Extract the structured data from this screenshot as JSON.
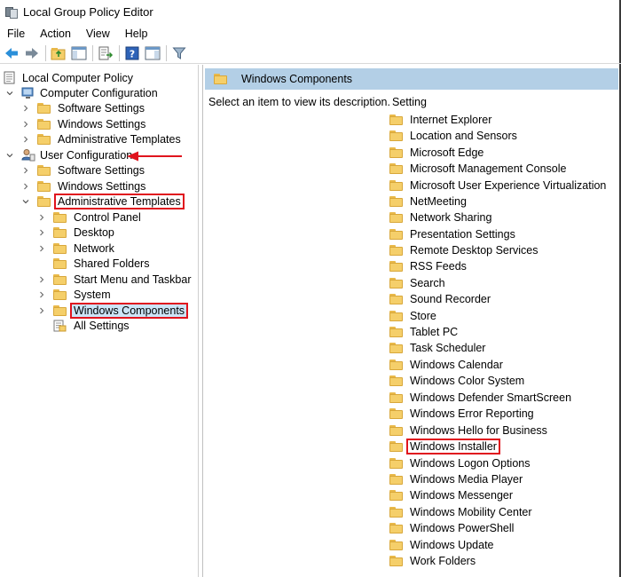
{
  "window": {
    "title": "Local Group Policy Editor"
  },
  "menu": [
    "File",
    "Action",
    "View",
    "Help"
  ],
  "tree": {
    "root": "Local Computer Policy",
    "computer_config": "Computer Configuration",
    "computer_children": [
      "Software Settings",
      "Windows Settings",
      "Administrative Templates"
    ],
    "user_config": "User Configuration",
    "user_children": [
      "Software Settings",
      "Windows Settings",
      "Administrative Templates"
    ],
    "admin_children": [
      "Control Panel",
      "Desktop",
      "Network",
      "Shared Folders",
      "Start Menu and Taskbar",
      "System",
      "Windows Components",
      "All Settings"
    ]
  },
  "right": {
    "header": "Windows Components",
    "description": "Select an item to view its description.",
    "column": "Setting",
    "settings": [
      "Internet Explorer",
      "Location and Sensors",
      "Microsoft Edge",
      "Microsoft Management Console",
      "Microsoft User Experience Virtualization",
      "NetMeeting",
      "Network Sharing",
      "Presentation Settings",
      "Remote Desktop Services",
      "RSS Feeds",
      "Search",
      "Sound Recorder",
      "Store",
      "Tablet PC",
      "Task Scheduler",
      "Windows Calendar",
      "Windows Color System",
      "Windows Defender SmartScreen",
      "Windows Error Reporting",
      "Windows Hello for Business",
      "Windows Installer",
      "Windows Logon Options",
      "Windows Media Player",
      "Windows Messenger",
      "Windows Mobility Center",
      "Windows PowerShell",
      "Windows Update",
      "Work Folders"
    ]
  },
  "colors": {
    "highlight": "#e0141e",
    "header_band": "#b3cfe6",
    "folder": "#f5cf6a",
    "arrow": "#e0141e"
  }
}
